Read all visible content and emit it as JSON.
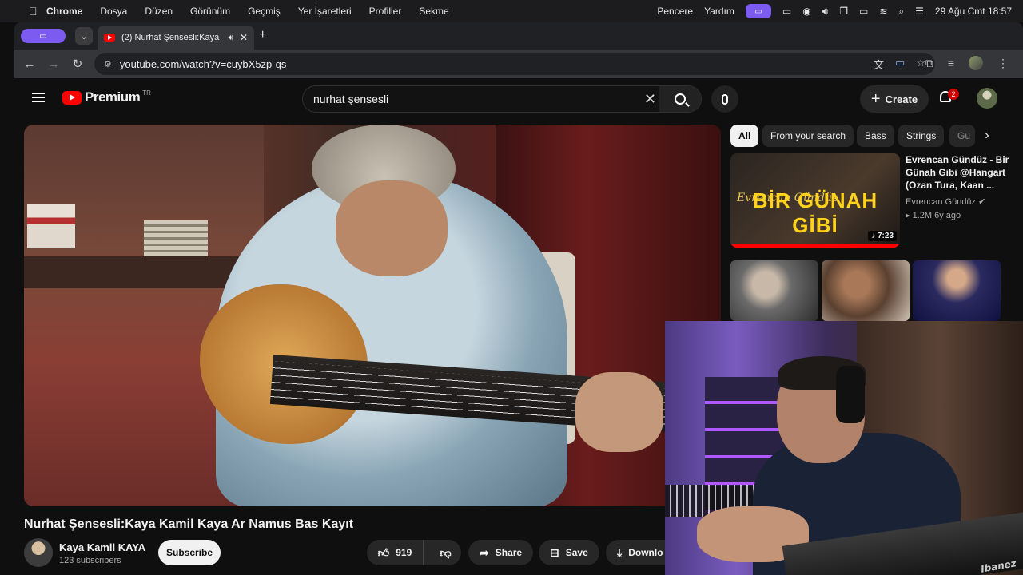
{
  "menubar": {
    "apple": "",
    "items": [
      "Chrome",
      "Dosya",
      "Düzen",
      "Görünüm",
      "Geçmiş",
      "Yer İşaretleri",
      "Profiller",
      "Sekme"
    ],
    "right_items": [
      "Pencere",
      "Yardım"
    ],
    "datetime": "29 Ağu Cmt  18:57"
  },
  "browser": {
    "tab_title": "(2) Nurhat Şensesli:Kaya",
    "url": "youtube.com/watch?v=cuybX5zp-qs"
  },
  "youtube": {
    "logo_text": "Premium",
    "country_code": "TR",
    "search_value": "nurhat şensesli",
    "create_label": "Create",
    "notif_count": "2"
  },
  "video": {
    "title": "Nurhat Şensesli:Kaya Kamil Kaya Ar Namus Bas Kayıt",
    "channel": "Kaya Kamil KAYA",
    "subscribers": "123 subscribers",
    "subscribe_label": "Subscribe",
    "likes": "919",
    "share_label": "Share",
    "save_label": "Save",
    "download_label": "Downlo"
  },
  "chips": [
    "All",
    "From your search",
    "Bass",
    "Strings",
    "Gu"
  ],
  "recommended": {
    "title": "Evrencan Gündüz - Bir Günah Gibi @Hangart (Ozan Tura, Kaan ...",
    "channel": "Evrencan Gündüz",
    "meta": "1.2M  6y ago",
    "duration": "7:23",
    "thumb_text": "BİR GÜNAH GİBİ",
    "thumb_sig": "Evrencan Gündüz"
  },
  "webcam": {
    "guitar_brand": "Ibanez"
  }
}
